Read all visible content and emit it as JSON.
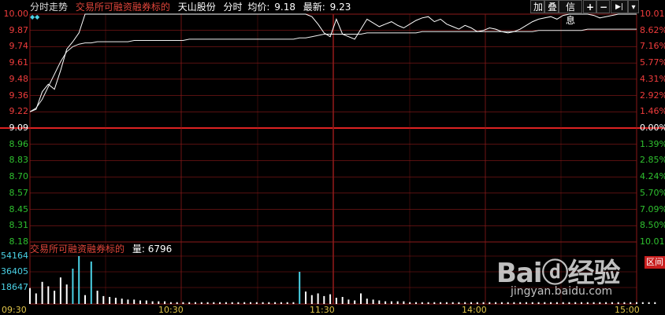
{
  "header": {
    "title": "分时走势",
    "tag": "交易所可融资融券标的",
    "stock": "天山股份",
    "mode": "分时",
    "avg_label": "均价:",
    "avg_value": "9.18",
    "latest_label": "最新:",
    "latest_value": "9.23",
    "diamonds": "◆◆"
  },
  "toolbar": {
    "add": "加",
    "overlay": "叠",
    "info": "信息",
    "zoom_in": "+",
    "zoom_out": "−",
    "next": "▶|",
    "more": "▾"
  },
  "price_axis": [
    "10.00",
    "9.87",
    "9.74",
    "9.61",
    "9.48",
    "9.36",
    "9.22",
    "9.09",
    "8.96",
    "8.83",
    "8.70",
    "8.57",
    "8.45",
    "8.31",
    "8.18"
  ],
  "pct_axis": [
    "10.01%",
    "8.62%",
    "7.16%",
    "5.77%",
    "4.31%",
    "2.92%",
    "1.46%",
    "0.00%",
    "1.39%",
    "2.85%",
    "4.24%",
    "5.70%",
    "7.09%",
    "8.50%",
    "10.01%"
  ],
  "volume_panel": {
    "tag": "交易所可融资融券标的",
    "vol_label": "量:",
    "vol_value": "6796",
    "axis": [
      "54164",
      "36405",
      "18647"
    ],
    "range_button": "区间"
  },
  "time_axis": [
    "09:30",
    "10:30",
    "11:30",
    "14:00",
    "15:00"
  ],
  "watermark": {
    "main": "Baiⓓ经验",
    "sub": "jingyan.baidu.com"
  },
  "colors": {
    "up": "#f03c3c",
    "down": "#2fc02f",
    "grid": "#8b1a1a",
    "price_line": "#ffffff",
    "avg_line": "#f0f0f0",
    "volume": "#ffffff",
    "volume_peak": "#4bd2e6"
  },
  "chart_data": {
    "type": "line",
    "price_range": [
      8.18,
      10.0
    ],
    "prev_close": 9.09,
    "price": [
      9.22,
      9.24,
      9.38,
      9.44,
      9.4,
      9.55,
      9.72,
      9.78,
      9.85,
      10.0,
      10.0,
      10.0,
      10.0,
      10.0,
      10.0,
      10.0,
      10.0,
      10.0,
      10.0,
      10.0,
      10.0,
      10.0,
      10.0,
      10.0,
      10.0,
      10.0,
      10.0,
      10.0,
      10.0,
      10.0,
      10.0,
      10.0,
      10.0,
      10.0,
      10.0,
      10.0,
      10.0,
      10.0,
      10.0,
      10.0,
      10.0,
      10.0,
      10.0,
      10.0,
      10.0,
      10.0,
      9.98,
      9.92,
      9.85,
      9.82,
      9.96,
      9.84,
      9.82,
      9.8,
      9.88,
      9.96,
      9.93,
      9.9,
      9.92,
      9.94,
      9.91,
      9.89,
      9.92,
      9.95,
      9.97,
      9.98,
      9.94,
      9.96,
      9.92,
      9.9,
      9.88,
      9.91,
      9.89,
      9.86,
      9.87,
      9.89,
      9.88,
      9.86,
      9.85,
      9.86,
      9.88,
      9.91,
      9.94,
      9.96,
      9.97,
      9.98,
      9.96,
      9.99,
      10.0,
      10.0,
      10.0,
      10.0,
      9.99,
      9.97,
      9.98,
      9.99,
      10.0,
      10.0,
      10.0,
      10.0
    ],
    "average": [
      9.22,
      9.25,
      9.32,
      9.42,
      9.52,
      9.62,
      9.7,
      9.74,
      9.76,
      9.77,
      9.77,
      9.78,
      9.78,
      9.78,
      9.78,
      9.78,
      9.78,
      9.79,
      9.79,
      9.79,
      9.79,
      9.79,
      9.79,
      9.79,
      9.79,
      9.79,
      9.8,
      9.8,
      9.8,
      9.8,
      9.8,
      9.8,
      9.8,
      9.8,
      9.8,
      9.8,
      9.8,
      9.8,
      9.8,
      9.8,
      9.8,
      9.8,
      9.8,
      9.8,
      9.81,
      9.81,
      9.82,
      9.83,
      9.84,
      9.84,
      9.84,
      9.84,
      9.84,
      9.84,
      9.84,
      9.85,
      9.85,
      9.85,
      9.85,
      9.85,
      9.85,
      9.85,
      9.85,
      9.85,
      9.86,
      9.86,
      9.86,
      9.86,
      9.86,
      9.86,
      9.86,
      9.86,
      9.86,
      9.86,
      9.86,
      9.86,
      9.86,
      9.86,
      9.86,
      9.86,
      9.86,
      9.86,
      9.86,
      9.87,
      9.87,
      9.87,
      9.87,
      9.87,
      9.87,
      9.87,
      9.87,
      9.88,
      9.88,
      9.88,
      9.88,
      9.88,
      9.88,
      9.88,
      9.88,
      9.88
    ],
    "volume": [
      18000,
      12000,
      25000,
      20000,
      15000,
      30000,
      22000,
      40000,
      54164,
      10000,
      48000,
      15000,
      9000,
      8000,
      7000,
      6000,
      5000,
      5000,
      4000,
      4000,
      3000,
      3000,
      3000,
      2000,
      2000,
      2000,
      2000,
      2000,
      2000,
      2000,
      2000,
      2000,
      2000,
      2000,
      2000,
      2000,
      2000,
      2000,
      2000,
      2000,
      2000,
      2000,
      2000,
      2000,
      36405,
      14000,
      10000,
      12000,
      9000,
      11000,
      7000,
      8000,
      5000,
      4000,
      12000,
      6000,
      5000,
      4000,
      3000,
      3000,
      3000,
      3000,
      2000,
      2000,
      2000,
      2000,
      2000,
      2000,
      2000,
      2000,
      2000,
      2000,
      2000,
      2000,
      2000,
      2000,
      2000,
      2000,
      2000,
      2000,
      2000,
      2000,
      2000,
      2000,
      2000,
      2000,
      2000,
      2000,
      2000,
      2000,
      2000,
      2000,
      2000,
      2000,
      2000,
      2000,
      2000,
      2000,
      2000,
      2000,
      2000,
      2000,
      2000
    ],
    "volume_ylim": [
      0,
      54164
    ]
  }
}
